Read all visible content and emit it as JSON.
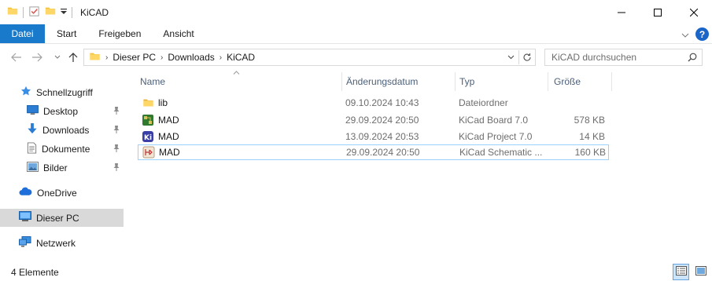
{
  "window": {
    "title": "KiCAD",
    "controls": {
      "minimize": "—",
      "maximize": "☐",
      "close": "✕"
    }
  },
  "ribbon": {
    "file_tab": "Datei",
    "tabs": [
      "Start",
      "Freigeben",
      "Ansicht"
    ],
    "help": "?"
  },
  "address": {
    "crumbs": [
      "Dieser PC",
      "Downloads",
      "KiCAD"
    ],
    "search_placeholder": "KiCAD durchsuchen"
  },
  "sidebar": {
    "items": [
      {
        "label": "Schnellzugriff",
        "icon": "star-icon",
        "pinned": false
      },
      {
        "label": "Desktop",
        "icon": "desktop-icon",
        "pinned": true
      },
      {
        "label": "Downloads",
        "icon": "download-arrow-icon",
        "pinned": true
      },
      {
        "label": "Dokumente",
        "icon": "document-icon",
        "pinned": true
      },
      {
        "label": "Bilder",
        "icon": "pictures-icon",
        "pinned": true
      },
      {
        "label": "OneDrive",
        "icon": "cloud-icon",
        "pinned": false
      },
      {
        "label": "Dieser PC",
        "icon": "computer-icon",
        "pinned": false,
        "selected": true
      },
      {
        "label": "Netzwerk",
        "icon": "network-icon",
        "pinned": false
      }
    ]
  },
  "columns": {
    "name": "Name",
    "date": "Änderungsdatum",
    "type": "Typ",
    "size": "Größe"
  },
  "files": [
    {
      "name": "lib",
      "date": "09.10.2024 10:43",
      "type": "Dateiordner",
      "size": "",
      "icon": "folder-icon"
    },
    {
      "name": "MAD",
      "date": "29.09.2024 20:50",
      "type": "KiCad Board 7.0",
      "size": "578 KB",
      "icon": "kicad-board-icon"
    },
    {
      "name": "MAD",
      "date": "13.09.2024 20:53",
      "type": "KiCad Project 7.0",
      "size": "14 KB",
      "icon": "kicad-project-icon"
    },
    {
      "name": "MAD",
      "date": "29.09.2024 20:50",
      "type": "KiCad Schematic ...",
      "size": "160 KB",
      "icon": "kicad-schematic-icon",
      "selected": true
    }
  ],
  "status": {
    "count": "4 Elemente"
  },
  "colors": {
    "accent": "#1979ca",
    "selection_border": "#99d1ff",
    "header_text": "#4c607a"
  }
}
